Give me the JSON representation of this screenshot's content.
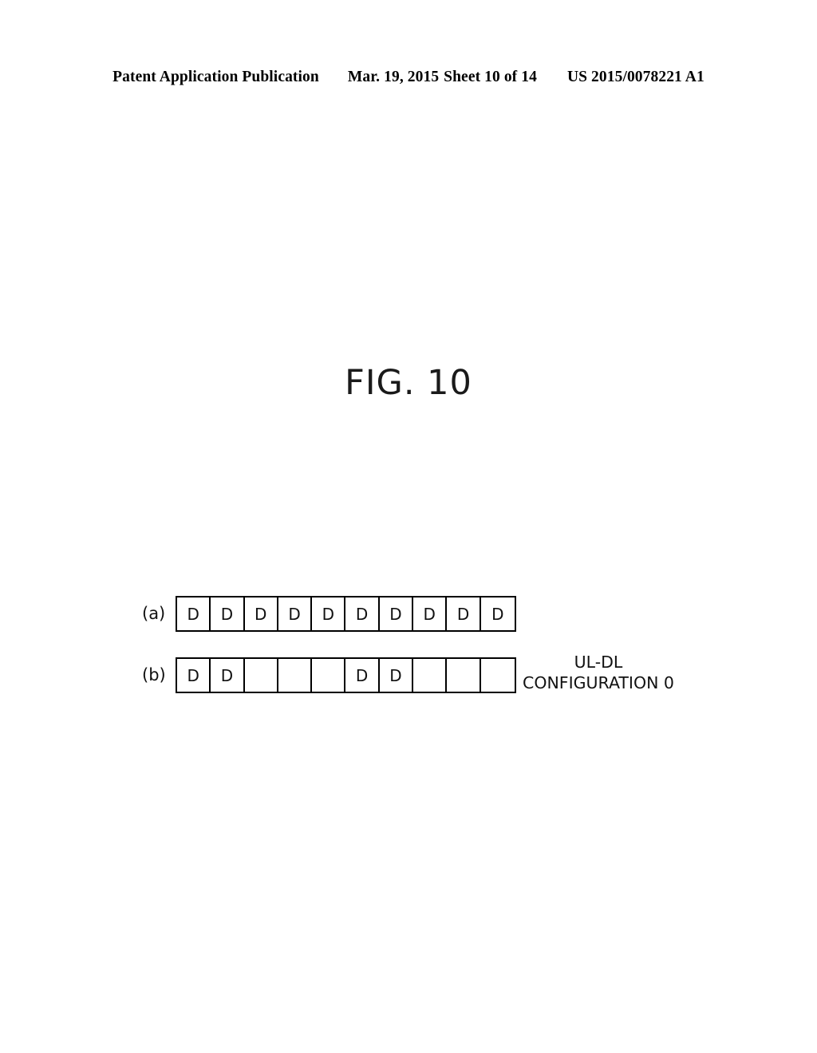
{
  "header": {
    "publication": "Patent Application Publication",
    "date": "Mar. 19, 2015",
    "sheet": "Sheet 10 of 14",
    "patent_number": "US 2015/0078221 A1"
  },
  "figure": {
    "title": "FIG. 10",
    "annotation": {
      "line1": "UL-DL",
      "line2": "CONFIGURATION 0"
    },
    "subfigures": [
      {
        "label": "(a)",
        "cells": [
          "D",
          "D",
          "D",
          "D",
          "D",
          "D",
          "D",
          "D",
          "D",
          "D"
        ]
      },
      {
        "label": "(b)",
        "cells": [
          "D",
          "D",
          "",
          "",
          "",
          "D",
          "D",
          "",
          "",
          ""
        ]
      }
    ]
  },
  "colors": {
    "ink": "#000000",
    "paper": "#ffffff"
  }
}
